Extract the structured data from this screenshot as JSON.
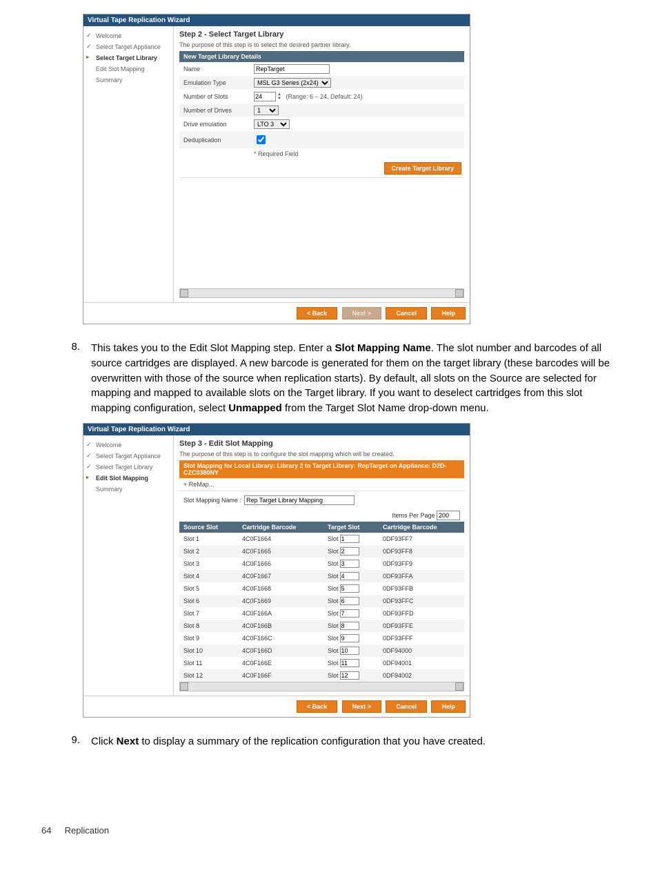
{
  "wizard_title": "Virtual Tape Replication Wizard",
  "w1": {
    "steps": [
      "Welcome",
      "Select Target Appliance",
      "Select Target Library",
      "Edit Slot Mapping",
      "Summary"
    ],
    "heading": "Step 2 - Select Target Library",
    "desc": "The purpose of this step is to select the desired partner library.",
    "section": "New Target Library Details",
    "rows": {
      "name_label": "Name",
      "name_value": "RepTarget",
      "emulation_label": "Emulation Type",
      "emulation_value": "MSL G3 Series (2x24)",
      "slots_label": "Number of Slots",
      "slots_value": "24",
      "slots_hint": "(Range: 6 – 24, Default: 24)",
      "drives_label": "Number of Drives",
      "drives_value": "1",
      "drive_em_label": "Drive emulation",
      "drive_em_value": "LTO 3",
      "dedup_label": "Deduplication"
    },
    "required": "* Required Field",
    "create_btn": "Create Target Library"
  },
  "step8": {
    "num": "8.",
    "text_parts": [
      "This takes you to the Edit Slot Mapping step. Enter a ",
      "Slot Mapping Name",
      ". The slot number and barcodes of all source cartridges are displayed. A new barcode is generated for them on the target library (these barcodes will be overwritten with those of the source when replication starts). By default, all slots on the Source are selected for mapping and mapped to available slots on the Target library. If you want to deselect cartridges from this slot mapping configuration, select ",
      "Unmapped",
      " from the Target Slot Name drop-down menu."
    ]
  },
  "w2": {
    "steps": [
      "Welcome",
      "Select Target Appliance",
      "Select Target Library",
      "Edit Slot Mapping",
      "Summary"
    ],
    "heading": "Step 3 - Edit Slot Mapping",
    "desc": "The purpose of this step is to configure the slot mapping which will be created.",
    "section": "Slot Mapping for Local Library: Library 2 to Target Library: RepTarget on Appliance: D2D-CZC0380NY",
    "remap": "+ ReMap...",
    "map_name_label": "Slot Mapping Name :",
    "map_name_value": "Rep Target Library Mapping",
    "ipp_label": "Items Per Page",
    "ipp_value": "200",
    "headers": [
      "Source Slot",
      "Cartridge Barcode",
      "Target Slot",
      "Cartridge Barcode"
    ],
    "tslabel": "Slot",
    "rows": [
      {
        "src": "Slot 1",
        "sbc": "4C0F1664",
        "ts": "1",
        "tbc": "0DF93FF7"
      },
      {
        "src": "Slot 2",
        "sbc": "4C0F1665",
        "ts": "2",
        "tbc": "0DF93FF8"
      },
      {
        "src": "Slot 3",
        "sbc": "4C0F1666",
        "ts": "3",
        "tbc": "0DF93FF9"
      },
      {
        "src": "Slot 4",
        "sbc": "4C0F1667",
        "ts": "4",
        "tbc": "0DF93FFA"
      },
      {
        "src": "Slot 5",
        "sbc": "4C0F1668",
        "ts": "5",
        "tbc": "0DF93FFB"
      },
      {
        "src": "Slot 6",
        "sbc": "4C0F1669",
        "ts": "6",
        "tbc": "0DF93FFC"
      },
      {
        "src": "Slot 7",
        "sbc": "4C0F166A",
        "ts": "7",
        "tbc": "0DF93FFD"
      },
      {
        "src": "Slot 8",
        "sbc": "4C0F166B",
        "ts": "8",
        "tbc": "0DF93FFE"
      },
      {
        "src": "Slot 9",
        "sbc": "4C0F166C",
        "ts": "9",
        "tbc": "0DF93FFF"
      },
      {
        "src": "Slot 10",
        "sbc": "4C0F166D",
        "ts": "10",
        "tbc": "0DF94000"
      },
      {
        "src": "Slot 11",
        "sbc": "4C0F166E",
        "ts": "11",
        "tbc": "0DF94001"
      },
      {
        "src": "Slot 12",
        "sbc": "4C0F166F",
        "ts": "12",
        "tbc": "0DF94002"
      }
    ]
  },
  "footer_btns": {
    "back": "< Back",
    "next": "Next >",
    "cancel": "Cancel",
    "help": "Help"
  },
  "step9": {
    "num": "9.",
    "text_parts": [
      "Click ",
      "Next",
      " to display a summary of the replication configuration that you have created."
    ]
  },
  "page_footer": {
    "num": "64",
    "section": "Replication"
  }
}
